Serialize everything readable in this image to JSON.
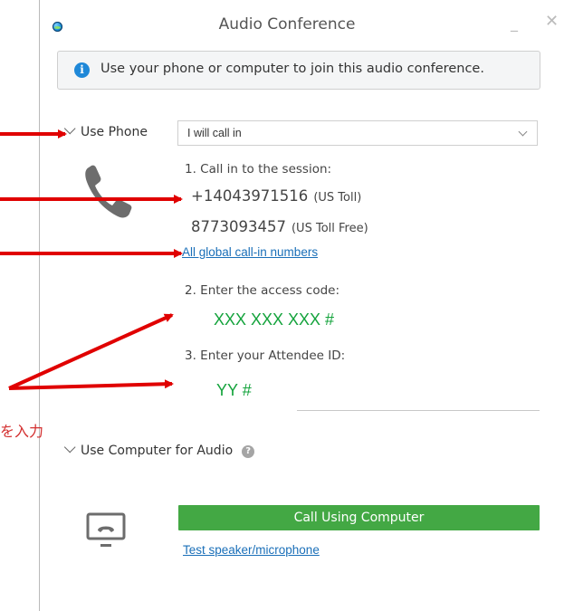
{
  "window": {
    "title": "Audio Conference",
    "minimize_glyph": "_",
    "close_glyph": "✕"
  },
  "banner": {
    "text": "Use your phone or computer to join this audio conference.",
    "icon": "info-icon"
  },
  "phone_section": {
    "header": "Use Phone",
    "dropdown_value": "I will call in",
    "step1": "1. Call in to the session:",
    "numbers": [
      {
        "number": "+14043971516",
        "tag": "(US Toll)"
      },
      {
        "number": "8773093457",
        "tag": "(US Toll Free)"
      }
    ],
    "global_link": "All global call-in numbers",
    "step2": "2. Enter the access code:",
    "access_code": "XXX XXX XXX #",
    "step3": "3. Enter your Attendee ID:",
    "attendee_id": "YY #"
  },
  "computer_section": {
    "header": "Use Computer for Audio",
    "help_glyph": "?",
    "call_button": "Call Using Computer",
    "test_link": "Test speaker/microphone"
  },
  "annotation": {
    "note_text": "を入力",
    "color": "#e00000"
  },
  "colors": {
    "accent_green": "#43a844",
    "code_green": "#14a33c",
    "link_blue": "#1a6fb8",
    "info_blue": "#1f88d8"
  }
}
